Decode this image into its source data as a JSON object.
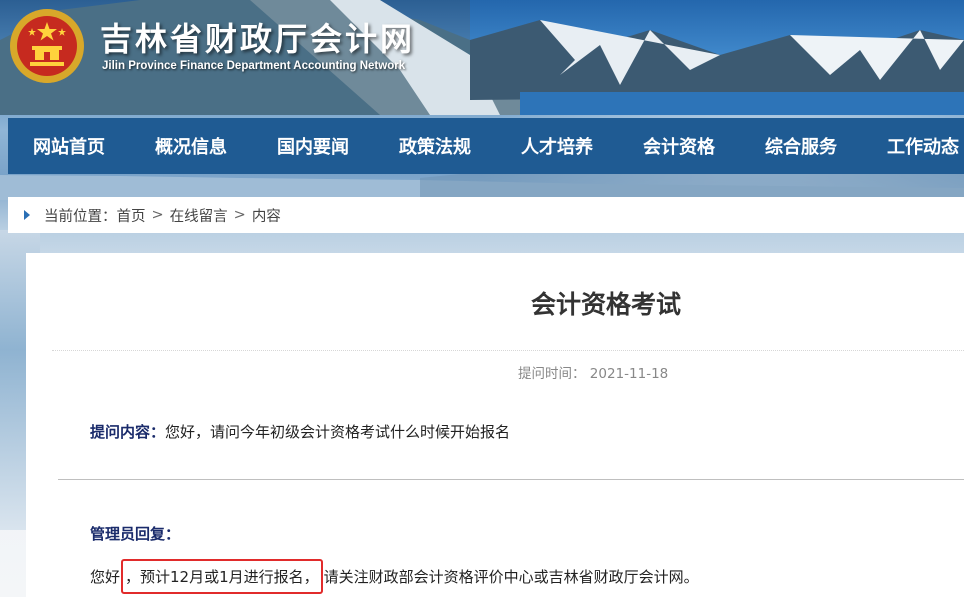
{
  "header": {
    "title": "吉林省财政厅会计网",
    "subtitle": "Jilin Province Finance Department Accounting Network",
    "emblem_icon": "national-emblem-icon"
  },
  "nav": {
    "items": [
      {
        "label": "网站首页"
      },
      {
        "label": "概况信息"
      },
      {
        "label": "国内要闻"
      },
      {
        "label": "政策法规"
      },
      {
        "label": "人才培养"
      },
      {
        "label": "会计资格"
      },
      {
        "label": "综合服务"
      },
      {
        "label": "工作动态"
      }
    ],
    "background_color": "#1f5b93"
  },
  "breadcrumb": {
    "prefix": "当前位置：",
    "items": [
      "首页",
      "在线留言",
      "内容"
    ],
    "separator": ">"
  },
  "article": {
    "title": "会计资格考试",
    "meta_label": "提问时间：",
    "meta_date": "2021-11-18",
    "question_label": "提问内容：",
    "question_text": "您好，请问今年初级会计资格考试什么时候开始报名",
    "reply_label": "管理员回复：",
    "reply_before": "您好",
    "reply_highlight": "，预计12月或1月进行报名，",
    "reply_after": "请关注财政部会计资格评价中心或吉林省财政厅会计网。"
  },
  "colors": {
    "label_blue": "#1a2b6b",
    "highlight_red": "#e12b2b"
  }
}
